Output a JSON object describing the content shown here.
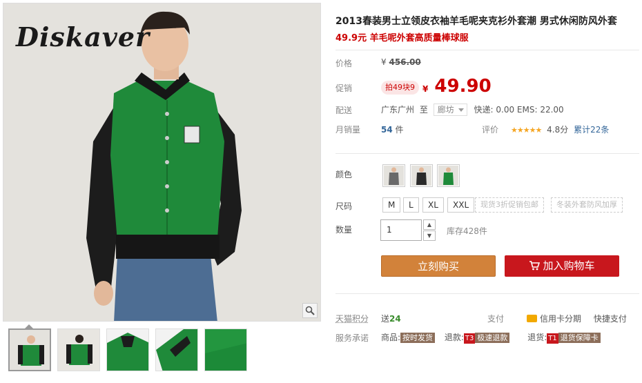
{
  "brand": "Diskaver",
  "product": {
    "title": "2013春装男士立领皮衣袖羊毛呢夹克衫外套潮 男式休闲防风外套",
    "subtitle": "49.9元 羊毛呢外套高质量棒球服"
  },
  "price": {
    "label": "价格",
    "currency": "¥",
    "original": "456.00"
  },
  "promo": {
    "label": "促销",
    "tag": "拍49块9",
    "currency": "¥",
    "price": "49.90"
  },
  "shipping": {
    "label": "配送",
    "from": "广东广州",
    "to_word": "至",
    "destination": "廊坊",
    "fee": "快递: 0.00 EMS: 22.00"
  },
  "sales": {
    "label": "月销量",
    "count": "54",
    "unit": "件",
    "rating_label": "评价",
    "stars": "★★★★★",
    "score": "4.8分",
    "reviews": "累计22条"
  },
  "color": {
    "label": "颜色"
  },
  "size": {
    "label": "尺码",
    "options": [
      "M",
      "L",
      "XL",
      "XXL"
    ],
    "extras": [
      "现货3折促销包邮",
      "冬装外套防风加厚"
    ]
  },
  "quantity": {
    "label": "数量",
    "value": "1",
    "stock": "库存428件"
  },
  "buttons": {
    "buy_now": "立刻购买",
    "add_cart": "加入购物车"
  },
  "points": {
    "label": "天猫积分",
    "text": "送",
    "value": "24"
  },
  "payment": {
    "label": "支付",
    "credit": "信用卡分期",
    "quick": "快捷支付"
  },
  "promise": {
    "label": "服务承诺",
    "goods_label": "商品:",
    "goods_tag": "按时发货",
    "refund_label": "退款:",
    "refund_badge": "T3",
    "refund_tag": "极速退款",
    "return_label": "退货:",
    "return_badge": "T1",
    "return_tag": "退货保障卡"
  },
  "colors": {
    "accent_red": "#c00",
    "buy_orange": "#d2823a",
    "cart_red": "#c8171d"
  }
}
